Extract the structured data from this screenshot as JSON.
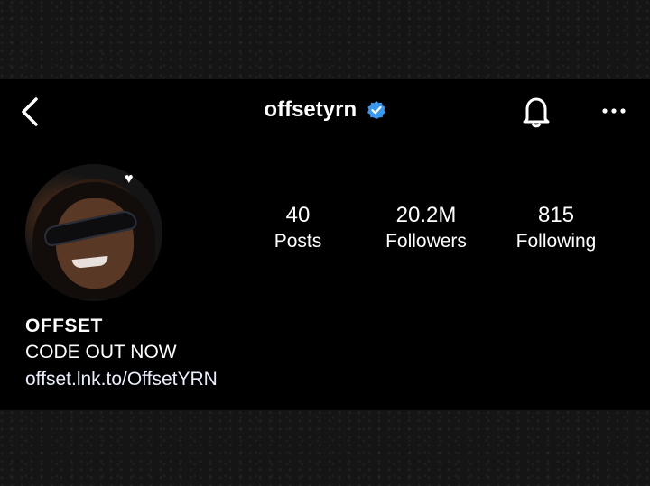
{
  "header": {
    "username": "offsetyrn",
    "verified": true,
    "icons": {
      "back": "chevron-left-icon",
      "verified": "verified-badge-icon",
      "notifications": "bell-icon",
      "more": "more-horizontal-icon"
    },
    "verified_color": "#3897f0"
  },
  "profile": {
    "avatar_badge": "♥",
    "stats": {
      "posts": {
        "count": "40",
        "label": "Posts"
      },
      "followers": {
        "count": "20.2M",
        "label": "Followers"
      },
      "following": {
        "count": "815",
        "label": "Following"
      }
    },
    "name": "OFFSET",
    "bio": "CODE OUT NOW",
    "link": "offset.lnk.to/OffsetYRN"
  }
}
